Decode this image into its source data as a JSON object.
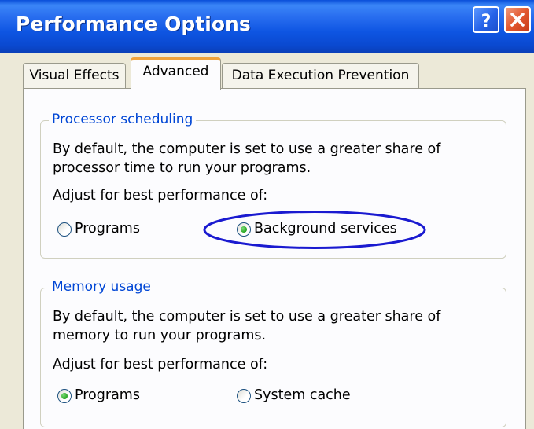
{
  "window": {
    "title": "Performance Options",
    "buttons": {
      "help": "?",
      "close": "×"
    }
  },
  "tabs": [
    {
      "label": "Visual Effects",
      "selected": false
    },
    {
      "label": "Advanced",
      "selected": true
    },
    {
      "label": "Data Execution Prevention",
      "selected": false
    }
  ],
  "processor_scheduling": {
    "heading": "Processor scheduling",
    "description_line1": "By default, the computer is set to use a greater share of",
    "description_line2": "processor time to run your programs.",
    "adjust_label": "Adjust for best performance of:",
    "options": [
      {
        "label": "Programs",
        "selected": false
      },
      {
        "label": "Background services",
        "selected": true,
        "highlighted": true
      }
    ]
  },
  "memory_usage": {
    "heading": "Memory usage",
    "description_line1": "By default, the computer is set to use a greater share of",
    "description_line2": "memory to run your programs.",
    "adjust_label": "Adjust for best performance of:",
    "options": [
      {
        "label": "Programs",
        "selected": true
      },
      {
        "label": "System cache",
        "selected": false
      }
    ]
  },
  "colors": {
    "titlebar": "#0a49d0",
    "accent_tab": "#f0a33c",
    "group_heading": "#0046d5",
    "highlight_ellipse": "#1a1ad0",
    "radio_dot": "#23a41f"
  },
  "icons": {
    "help": "question-mark-icon",
    "close": "close-x-icon"
  }
}
